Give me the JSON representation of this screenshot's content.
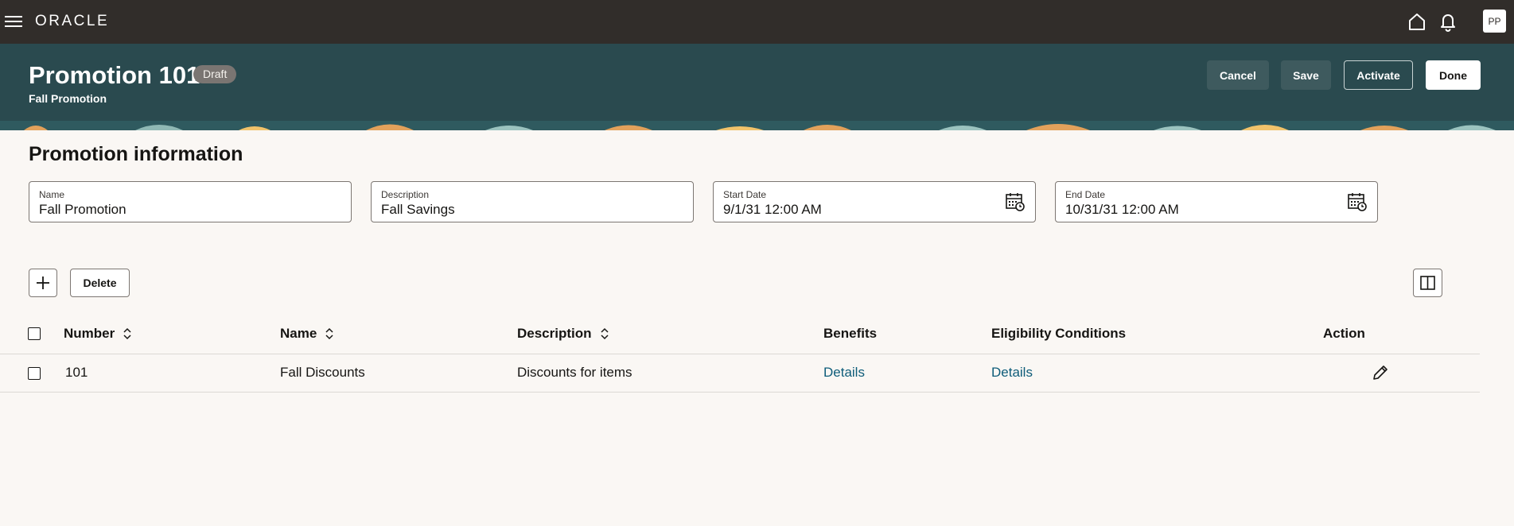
{
  "app": {
    "brand": "ORACLE",
    "user_initials": "PP"
  },
  "header": {
    "title": "Promotion 101",
    "status": "Draft",
    "subtitle": "Fall Promotion",
    "buttons": {
      "cancel": "Cancel",
      "save": "Save",
      "activate": "Activate",
      "done": "Done"
    }
  },
  "section": {
    "title": "Promotion information"
  },
  "fields": {
    "name": {
      "label": "Name",
      "value": "Fall Promotion"
    },
    "description": {
      "label": "Description",
      "value": "Fall Savings"
    },
    "start_date": {
      "label": "Start Date",
      "value": "9/1/31 12:00 AM"
    },
    "end_date": {
      "label": "End Date",
      "value": "10/31/31 12:00 AM"
    }
  },
  "toolbar": {
    "delete_label": "Delete"
  },
  "table": {
    "columns": {
      "number": "Number",
      "name": "Name",
      "description": "Description",
      "benefits": "Benefits",
      "eligibility": "Eligibility Conditions",
      "action": "Action"
    },
    "rows": [
      {
        "number": "101",
        "name": "Fall Discounts",
        "description": "Discounts for items",
        "benefits": "Details",
        "eligibility": "Details"
      }
    ]
  },
  "colors": {
    "topbar": "#312d2a",
    "header": "#2a4a4f",
    "link": "#0e5c79",
    "background": "#faf7f4"
  },
  "icons": [
    "menu-icon",
    "home-icon",
    "bell-icon",
    "plus-icon",
    "calendar-icon",
    "sort-icon",
    "panel-icon",
    "pencil-icon"
  ]
}
